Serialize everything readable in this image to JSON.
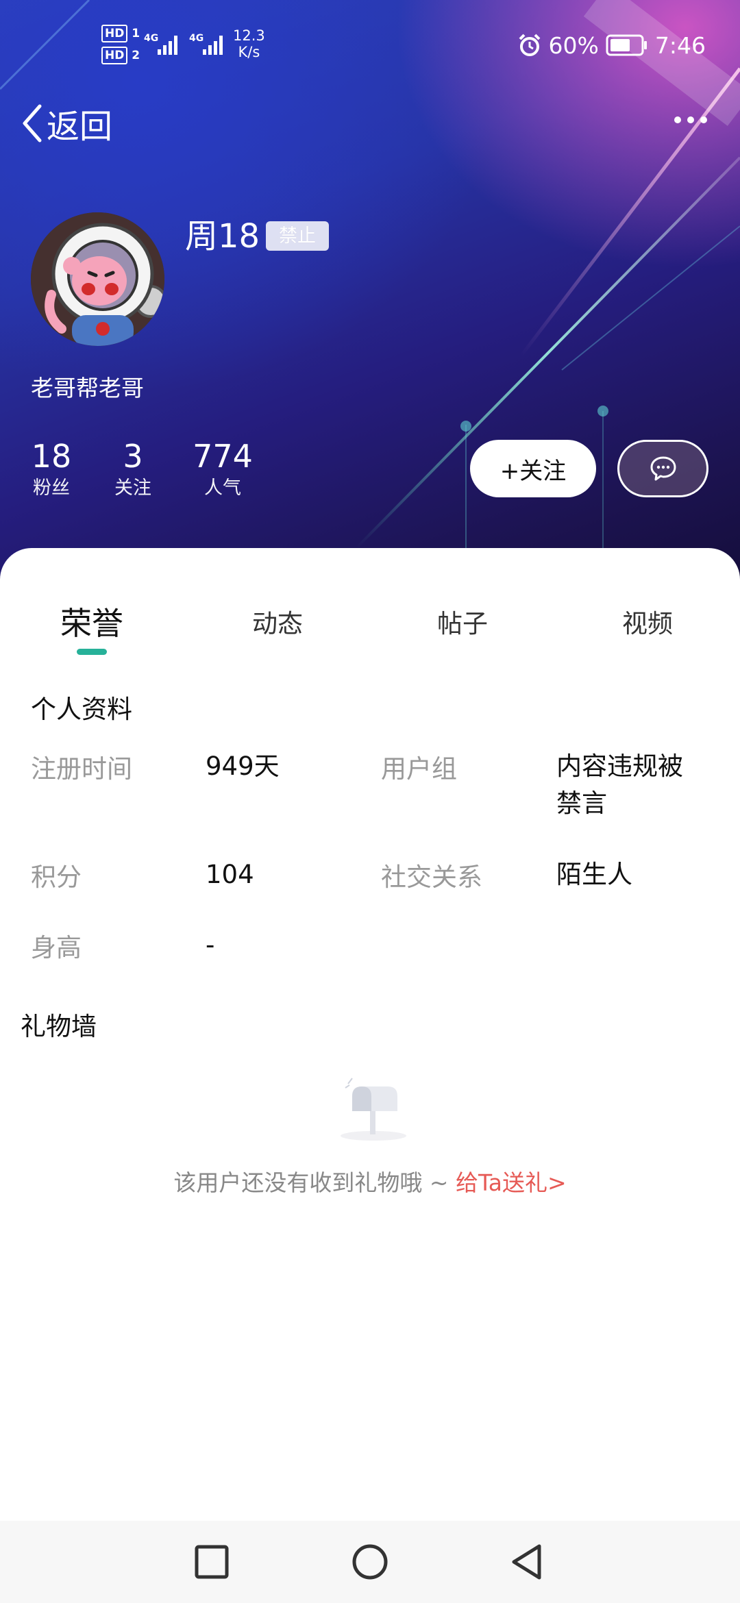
{
  "status_bar": {
    "hd1": "HD",
    "hd1_sim": "1",
    "hd2": "HD",
    "hd2_sim": "2",
    "network1": "4G",
    "network2": "4G",
    "speed_value": "12.3",
    "speed_unit": "K/s",
    "battery": "60%",
    "time": "7:46",
    "icons": [
      "alarm-icon",
      "battery-icon",
      "signal-icon"
    ]
  },
  "nav": {
    "back_label": "返回",
    "more_icon": "more-dots-icon"
  },
  "profile": {
    "name": "周18",
    "status_badge": "禁止",
    "signature": "老哥帮老哥",
    "stats": [
      {
        "value": "18",
        "label": "粉丝"
      },
      {
        "value": "3",
        "label": "关注"
      },
      {
        "value": "774",
        "label": "人气"
      }
    ],
    "follow_label": "+关注",
    "message_icon": "chat-bubble-icon"
  },
  "tabs": [
    {
      "label": "荣誉",
      "active": true
    },
    {
      "label": "动态",
      "active": false
    },
    {
      "label": "帖子",
      "active": false
    },
    {
      "label": "视频",
      "active": false
    }
  ],
  "accent_color": "#27b199",
  "link_color": "#e65a55",
  "info": {
    "title": "个人资料",
    "register_label": "注册时间",
    "register_value": "949天",
    "group_label": "用户组",
    "group_value_line1": "内容违规被",
    "group_value_line2": "禁言",
    "points_label": "积分",
    "points_value": "104",
    "relation_label": "社交关系",
    "relation_value": "陌生人",
    "height_label": "身高",
    "height_value": "-"
  },
  "gifts": {
    "title": "礼物墙",
    "empty_text": "该用户还没有收到礼物哦 ~ ",
    "send_link": "给Ta送礼>",
    "empty_icon": "mailbox-icon"
  },
  "system_nav": {
    "icons": [
      "recent-apps-icon",
      "home-icon",
      "back-icon"
    ]
  }
}
